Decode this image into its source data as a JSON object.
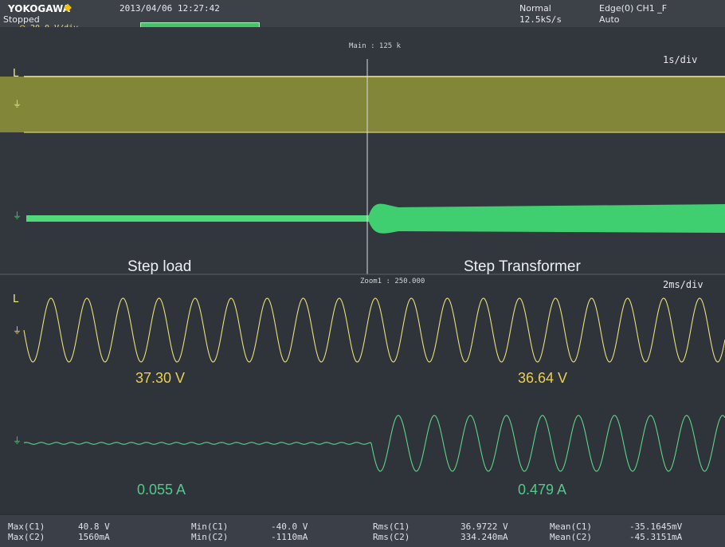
{
  "header": {
    "brand": "YOKOGAWA",
    "status": "Stopped",
    "datetime": "2013/04/06 12:27:42",
    "acq_mode": "Normal",
    "sample_rate": "12.5kS/s",
    "trigger": "Edge(0) CH1 _F",
    "trigger_mode": "Auto",
    "ch_scale": "20.0 V/div"
  },
  "main_window": {
    "timebase": "1s/div",
    "zoom_label": "Main : 125 k"
  },
  "zoom_window": {
    "timebase": "2ms/div",
    "zoom_label": "Zoom1 : 250.000"
  },
  "annotations": {
    "left_title": "Step load",
    "right_title": "Step Transformer",
    "v_left": "37.30 V",
    "v_right": "36.64 V",
    "a_left": "0.055 A",
    "a_right": "0.479 A"
  },
  "measurements": {
    "row1": [
      {
        "name": "Max(C1)",
        "value": "40.8 V"
      },
      {
        "name": "Min(C1)",
        "value": "-40.0 V"
      },
      {
        "name": "Rms(C1)",
        "value": "36.9722 V"
      },
      {
        "name": "Mean(C1)",
        "value": "-35.1645mV"
      }
    ],
    "row2": [
      {
        "name": "Max(C2)",
        "value": "1560mA"
      },
      {
        "name": "Min(C2)",
        "value": "-1110mA"
      },
      {
        "name": "Rms(C2)",
        "value": "334.240mA"
      },
      {
        "name": "Mean(C2)",
        "value": "-45.3151mA"
      }
    ]
  },
  "colors": {
    "ch1": "#e8e07a",
    "ch2": "#5fd38a",
    "band": "#9aa23a"
  }
}
